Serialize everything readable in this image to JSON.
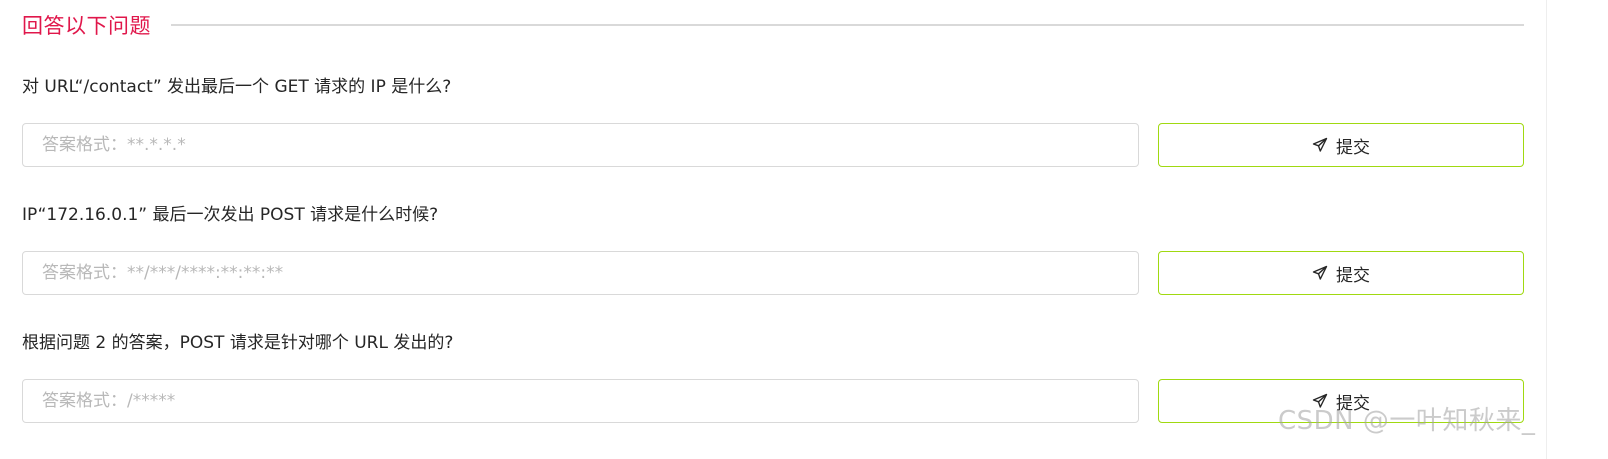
{
  "section": {
    "title": "回答以下问题"
  },
  "questions": [
    {
      "text": "对 URL“/contact” 发出最后一个 GET 请求的 IP 是什么?",
      "placeholder": "答案格式：**.*.*.*",
      "submit_label": "提交",
      "submit_icon": "send-icon"
    },
    {
      "text": "IP“172.16.0.1” 最后一次发出 POST 请求是什么时候?",
      "placeholder": "答案格式：**/***/****:**:**:**",
      "submit_label": "提交",
      "submit_icon": "send-icon"
    },
    {
      "text": "根据问题 2 的答案，POST 请求是针对哪个 URL 发出的?",
      "placeholder": "答案格式：/*****",
      "submit_label": "提交",
      "submit_icon": "send-icon"
    }
  ],
  "watermark": "CSDN @一叶知秋来_",
  "colors": {
    "title_accent": "#e0174b",
    "button_border": "#a0d911",
    "input_border": "#d9d9d9",
    "placeholder": "#b8b8b8"
  }
}
